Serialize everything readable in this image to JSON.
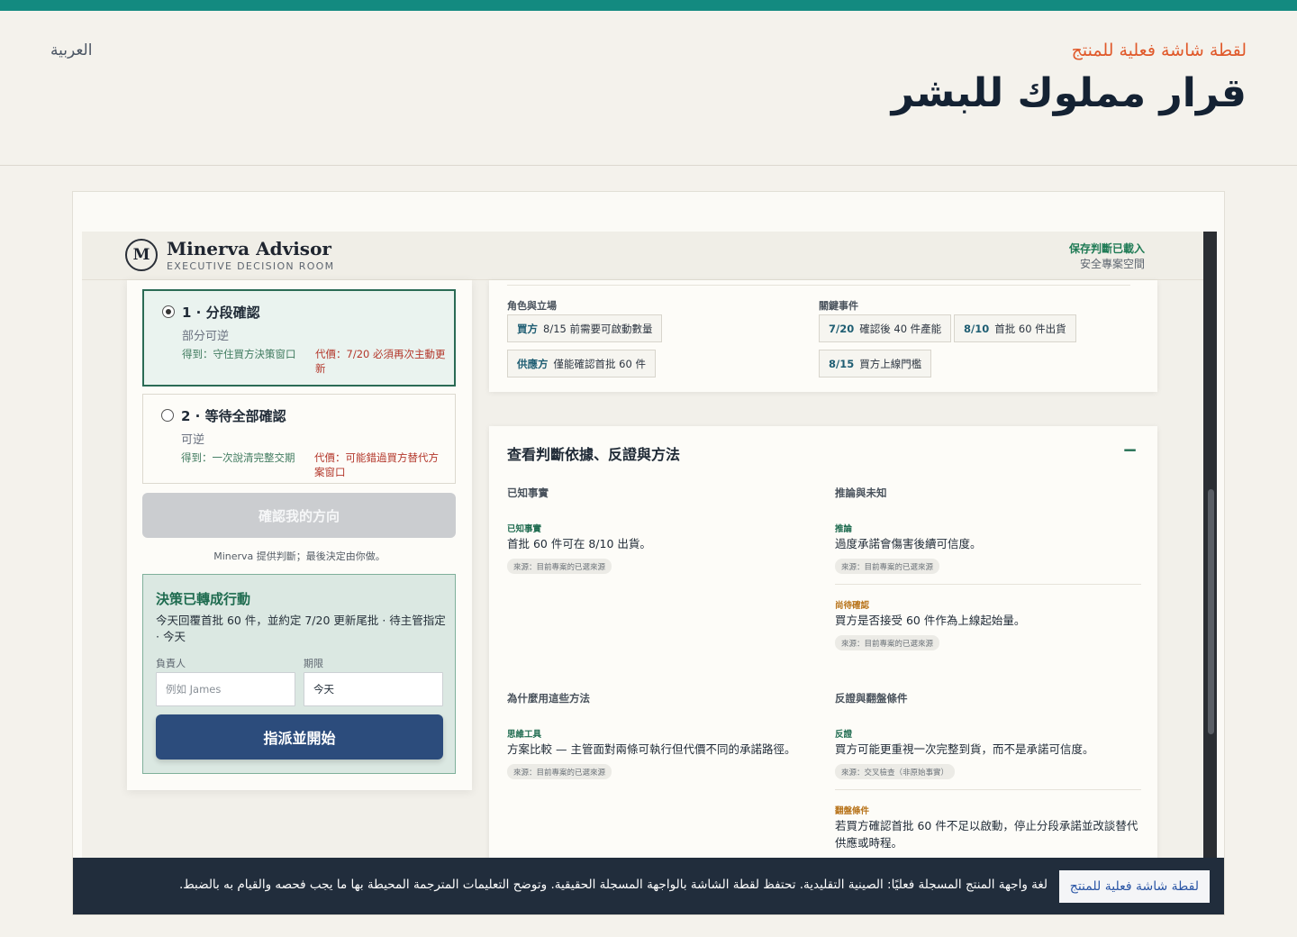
{
  "page": {
    "language_switch": "العربية",
    "eyebrow": "لقطة شاشة فعلية للمنتج",
    "title": "قرار مملوك للبشر"
  },
  "app": {
    "brand_initial": "M",
    "brand_name": "Minerva Advisor",
    "brand_subtitle": "EXECUTIVE DECISION ROOM",
    "saved_status": "保存判斷已載入",
    "workspace": "安全專案空間"
  },
  "options": [
    {
      "title": "1 · 分段確認",
      "subtitle": "部分可逆",
      "gain": "得到：守住買方決策窗口",
      "cost": "代價：7/20 必須再次主動更新",
      "selected": true
    },
    {
      "title": "2 · 等待全部確認",
      "subtitle": "可逆",
      "gain": "得到：一次說清完整交期",
      "cost": "代價：可能錯過買方替代方案窗口",
      "selected": false
    }
  ],
  "confirm_button": "確認我的方向",
  "minerva_note": "Minerva 提供判斷；最後決定由你做。",
  "action": {
    "title": "決策已轉成行動",
    "description": "今天回覆首批 60 件，並約定 7/20 更新尾批 · 待主管指定 · 今天",
    "owner_label": "負責人",
    "owner_placeholder": "例如 James",
    "due_label": "期限",
    "due_value": "今天",
    "assign_button": "指派並開始"
  },
  "roles": {
    "heading": "角色與立場",
    "chips": [
      {
        "who": "買方",
        "text": "8/15 前需要可啟動數量"
      },
      {
        "who": "供應方",
        "text": "僅能確認首批 60 件"
      }
    ]
  },
  "events": {
    "heading": "關鍵事件",
    "chips": [
      {
        "date": "7/20",
        "text": "確認後 40 件產能"
      },
      {
        "date": "8/10",
        "text": "首批 60 件出貨"
      },
      {
        "date": "8/15",
        "text": "買方上線門檻"
      }
    ]
  },
  "evidence": {
    "title": "查看判斷依據、反證與方法",
    "collapse_icon": "minus-icon",
    "known_heading": "已知事實",
    "known": {
      "tag": "已知事實",
      "text": "首批 60 件可在 8/10 出貨。",
      "source": "來源：目前專案的已選來源"
    },
    "inference_heading": "推論與未知",
    "inference": {
      "tag": "推論",
      "text": "過度承諾會傷害後續可信度。",
      "source": "來源：目前專案的已選來源"
    },
    "pending": {
      "tag": "尚待確認",
      "text": "買方是否接受 60 件作為上線起始量。",
      "source": "來源：目前專案的已選來源"
    },
    "method_heading": "為什麼用這些方法",
    "method": {
      "tag": "思維工具",
      "text": "方案比較 — 主管面對兩條可執行但代價不同的承諾路徑。",
      "source": "來源：目前專案的已選來源"
    },
    "counter_heading": "反證與翻盤條件",
    "counter": {
      "tag": "反證",
      "text": "買方可能更重視一次完整到貨，而不是承諾可信度。",
      "source": "來源：交叉檢查（非原始事實）"
    },
    "flip": {
      "tag": "翻盤條件",
      "text": "若買方確認首批 60 件不足以啟動，停止分段承諾並改談替代供應或時程。"
    }
  },
  "banner": {
    "badge": "لقطة شاشة فعلية للمنتج",
    "text": "لغة واجهة المنتج المسجلة فعليًا: الصينية التقليدية. تحتفظ لقطة الشاشة بالواجهة المسجلة الحقيقية. وتوضح التعليمات المترجمة المحيطة بها ما يجب فحصه والقيام به بالضبط."
  },
  "colors": {
    "accent_teal": "#138a80",
    "eyebrow_orange": "#e0592a",
    "primary_button": "#2c4c7c",
    "success_green": "#1e6b4f",
    "cost_red": "#b3372b",
    "banner_bg": "#212d3c"
  }
}
